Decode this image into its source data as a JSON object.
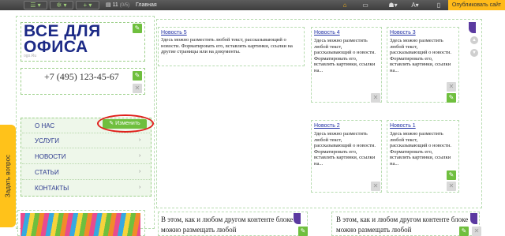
{
  "toolbar": {
    "page_number": "11",
    "page_count": "(0/5)",
    "page_name": "Главная",
    "publish_label": "Опубликовать сайт"
  },
  "logo": {
    "line1": "ВСЕ ДЛЯ",
    "line2": "ОФИСА",
    "sub": "ogo.Ru"
  },
  "phone": "+7 (495) 123-45-67",
  "menu": {
    "items": [
      "О НАС",
      "УСЛУГИ",
      "НОВОСТИ",
      "СТАТЬИ",
      "КОНТАКТЫ"
    ],
    "edit_label": "Изменить"
  },
  "side_tab": "Задать вопрос",
  "news": [
    {
      "title": "Новость 5",
      "text": "Здесь можно разместить любой текст, рассказывающий о новости. Форматировать его, вставлять картинки, ссылки на другие страницы или на документы."
    },
    {
      "title": "Новость 4",
      "text": "Здесь можно разместить любой текст, рассказывающий о новости. Форматировать его, вставлять картинки, ссылки на..."
    },
    {
      "title": "Новость 3",
      "text": "Здесь можно разместить любой текст, рассказывающий о новости. Форматировать его, вставлять картинки, ссылки на..."
    },
    {
      "title": "Новость 2",
      "text": "Здесь можно разместить любой текст, рассказывающий о новости. Форматировать его, вставлять картинки, ссылки на..."
    },
    {
      "title": "Новость 1",
      "text": "Здесь можно разместить любой текст, рассказывающий о новости. Форматировать его, вставлять картинки, ссылки на..."
    }
  ],
  "footer": {
    "left": "В этом, как и любом другом контенте блоке можно размещать любой",
    "right": "В этом, как и любом другом контенте блоке можно размещать любой"
  },
  "colors": {
    "accent": "#6fbf3e",
    "publish": "#ffba1a",
    "logo": "#1c2a86",
    "highlight": "#e0201c"
  }
}
